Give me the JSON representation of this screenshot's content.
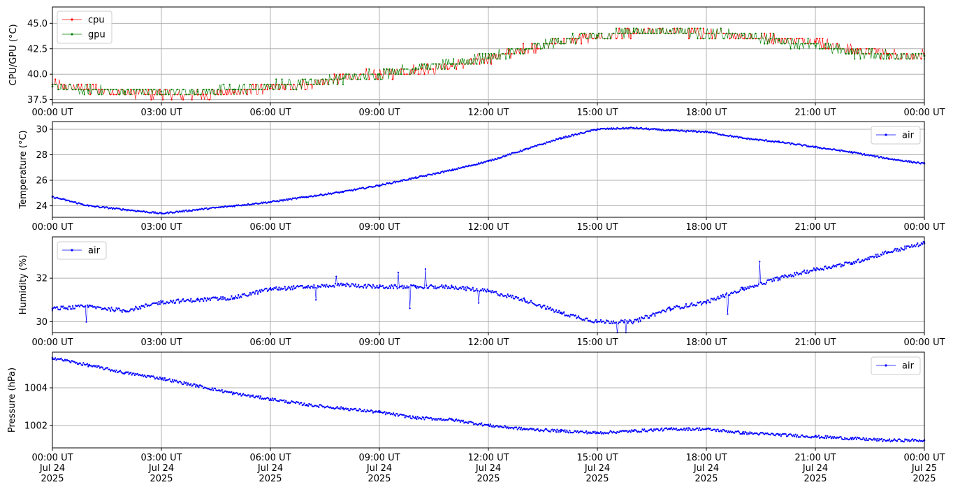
{
  "chart_data": [
    {
      "type": "line",
      "ylabel": "CPU/GPU (°C)",
      "ylim": [
        37.2,
        46.6
      ],
      "yticks": [
        37.5,
        40.0,
        42.5,
        45.0
      ],
      "ytick_labels": [
        "37.5",
        "40.0",
        "42.5",
        "45.0"
      ],
      "xlim": [
        "00:00",
        "24:00"
      ],
      "xtick_labels": [
        "00:00 UT",
        "03:00 UT",
        "06:00 UT",
        "09:00 UT",
        "12:00 UT",
        "15:00 UT",
        "18:00 UT",
        "21:00 UT",
        "00:00 UT"
      ],
      "grid": true,
      "legend_placement": "upper-left",
      "series": [
        {
          "name": "cpu",
          "color": "#ff0000",
          "x_hours": [
            0,
            1,
            2,
            3,
            4,
            5,
            6,
            7,
            8,
            9,
            10,
            11,
            12,
            13,
            14,
            15,
            16,
            17,
            18,
            19,
            20,
            21,
            22,
            23,
            24
          ],
          "values": [
            39.0,
            38.5,
            38.2,
            38.0,
            38.0,
            38.2,
            38.6,
            39.0,
            39.6,
            40.0,
            40.4,
            40.8,
            41.6,
            42.4,
            43.2,
            43.6,
            44.0,
            44.2,
            44.0,
            43.8,
            43.4,
            43.2,
            42.4,
            42.0,
            41.8
          ]
        },
        {
          "name": "gpu",
          "color": "#008000",
          "x_hours": [
            0,
            1,
            2,
            3,
            4,
            5,
            6,
            7,
            8,
            9,
            10,
            11,
            12,
            13,
            14,
            15,
            16,
            17,
            18,
            19,
            20,
            21,
            22,
            23,
            24
          ],
          "values": [
            38.8,
            38.4,
            38.3,
            38.3,
            38.3,
            38.5,
            38.8,
            39.2,
            39.6,
            40.0,
            40.6,
            41.0,
            41.6,
            42.4,
            43.2,
            43.8,
            44.2,
            44.3,
            44.0,
            43.8,
            43.3,
            42.8,
            42.2,
            41.9,
            41.8
          ]
        }
      ]
    },
    {
      "type": "line",
      "ylabel": "Temperature (°C)",
      "ylim": [
        23.1,
        30.6
      ],
      "yticks": [
        24,
        26,
        28,
        30
      ],
      "ytick_labels": [
        "24",
        "26",
        "28",
        "30"
      ],
      "xtick_labels": [
        "00:00 UT",
        "03:00 UT",
        "06:00 UT",
        "09:00 UT",
        "12:00 UT",
        "15:00 UT",
        "18:00 UT",
        "21:00 UT",
        "00:00 UT"
      ],
      "grid": true,
      "legend_placement": "upper-right",
      "series": [
        {
          "name": "air",
          "color": "#0000ff",
          "x_hours": [
            0,
            1,
            2,
            3,
            4,
            5,
            6,
            7,
            8,
            9,
            10,
            11,
            12,
            13,
            14,
            15,
            16,
            17,
            18,
            19,
            20,
            21,
            22,
            23,
            24
          ],
          "values": [
            24.7,
            24.0,
            23.7,
            23.4,
            23.7,
            24.0,
            24.3,
            24.7,
            25.1,
            25.6,
            26.2,
            26.8,
            27.5,
            28.4,
            29.3,
            30.0,
            30.1,
            29.9,
            29.8,
            29.3,
            29.0,
            28.6,
            28.2,
            27.7,
            27.3
          ]
        }
      ]
    },
    {
      "type": "line",
      "ylabel": "Humidity (%)",
      "ylim": [
        29.5,
        33.9
      ],
      "yticks": [
        30,
        32
      ],
      "ytick_labels": [
        "30",
        "32"
      ],
      "xtick_labels": [
        "00:00 UT",
        "03:00 UT",
        "06:00 UT",
        "09:00 UT",
        "12:00 UT",
        "15:00 UT",
        "18:00 UT",
        "21:00 UT",
        "00:00 UT"
      ],
      "grid": true,
      "legend_placement": "upper-left",
      "series": [
        {
          "name": "air",
          "color": "#0000ff",
          "x_hours": [
            0,
            1,
            2,
            3,
            4,
            5,
            6,
            7,
            8,
            9,
            10,
            11,
            12,
            13,
            14,
            15,
            16,
            17,
            18,
            19,
            20,
            21,
            22,
            23,
            24
          ],
          "values": [
            30.6,
            30.7,
            30.5,
            30.9,
            31.0,
            31.1,
            31.5,
            31.6,
            31.7,
            31.6,
            31.6,
            31.6,
            31.4,
            31.0,
            30.4,
            30.0,
            30.0,
            30.6,
            30.9,
            31.5,
            32.0,
            32.4,
            32.7,
            33.2,
            33.6
          ]
        }
      ]
    },
    {
      "type": "line",
      "ylabel": "Pressure (hPa)",
      "ylim": [
        1000.8,
        1005.9
      ],
      "yticks": [
        1002,
        1004
      ],
      "ytick_labels": [
        "1002",
        "1004"
      ],
      "xtick_labels": [
        "00:00 UT\nJul 24\n2025",
        "03:00 UT\nJul 24\n2025",
        "06:00 UT\nJul 24\n2025",
        "09:00 UT\nJul 24\n2025",
        "12:00 UT\nJul 24\n2025",
        "15:00 UT\nJul 24\n2025",
        "18:00 UT\nJul 24\n2025",
        "21:00 UT\nJul 24\n2025",
        "00:00 UT\nJul 25\n2025"
      ],
      "grid": true,
      "legend_placement": "upper-right",
      "series": [
        {
          "name": "air",
          "color": "#0000ff",
          "x_hours": [
            0,
            1,
            2,
            3,
            4,
            5,
            6,
            7,
            8,
            9,
            10,
            11,
            12,
            13,
            14,
            15,
            16,
            17,
            18,
            19,
            20,
            21,
            22,
            23,
            24
          ],
          "values": [
            1005.6,
            1005.2,
            1004.8,
            1004.5,
            1004.1,
            1003.7,
            1003.4,
            1003.1,
            1002.9,
            1002.7,
            1002.4,
            1002.3,
            1002.0,
            1001.8,
            1001.7,
            1001.6,
            1001.7,
            1001.8,
            1001.8,
            1001.6,
            1001.5,
            1001.4,
            1001.3,
            1001.2,
            1001.2
          ]
        }
      ]
    }
  ]
}
